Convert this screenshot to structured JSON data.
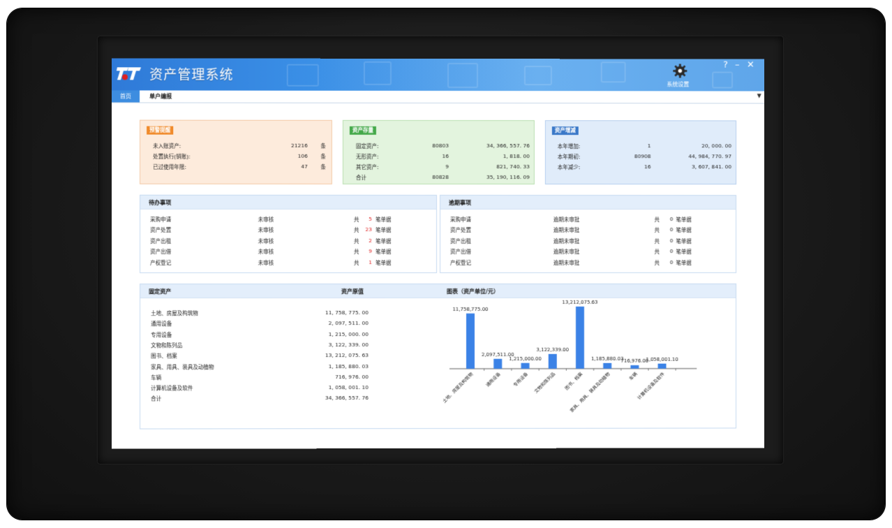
{
  "app": {
    "title": "资产管理系统",
    "settings_label": "系统设置"
  },
  "window_controls": {
    "help": "?",
    "minimize": "–",
    "close": "✕"
  },
  "tabs": [
    {
      "label": "首页"
    },
    {
      "label": "单户编报"
    }
  ],
  "warning": {
    "badge": "预警提醒",
    "rows": [
      {
        "label": "未入账资产:",
        "count": "21216",
        "unit": "条"
      },
      {
        "label": "处置执行(销账):",
        "count": "106",
        "unit": "条"
      },
      {
        "label": "已过使用年限:",
        "count": "47",
        "unit": "条"
      }
    ]
  },
  "inventory": {
    "badge": "资产存量",
    "rows": [
      {
        "label": "固定资产:",
        "count": "80803",
        "amount": "34, 366, 557. 76"
      },
      {
        "label": "无形资产:",
        "count": "16",
        "amount": "1, 818. 00"
      },
      {
        "label": "其它资产:",
        "count": "9",
        "amount": "821, 740. 33"
      },
      {
        "label": "合计",
        "count": "80828",
        "amount": "35, 190, 116. 09"
      }
    ]
  },
  "change": {
    "badge": "资产增减",
    "rows": [
      {
        "label": "本年增加:",
        "count": "1",
        "amount": "20, 000. 00"
      },
      {
        "label": "本年期初:",
        "count": "80908",
        "amount": "44, 984, 770. 97"
      },
      {
        "label": "本年减少:",
        "count": "16",
        "amount": "3, 607, 841. 00"
      }
    ]
  },
  "todo": {
    "title": "待办事项",
    "rows": [
      {
        "item": "采购申请",
        "status": "未审核",
        "prefix": "共",
        "count": "5",
        "suffix": "笔单据"
      },
      {
        "item": "资产处置",
        "status": "未审核",
        "prefix": "共",
        "count": "23",
        "suffix": "笔单据"
      },
      {
        "item": "资产出租",
        "status": "未审核",
        "prefix": "共",
        "count": "2",
        "suffix": "笔单据"
      },
      {
        "item": "资产出借",
        "status": "未审核",
        "prefix": "共",
        "count": "9",
        "suffix": "笔单据"
      },
      {
        "item": "产权登记",
        "status": "未审核",
        "prefix": "共",
        "count": "1",
        "suffix": "笔单据"
      }
    ]
  },
  "overdue": {
    "title": "逾期事项",
    "rows": [
      {
        "item": "采购申请",
        "status": "逾期未审批",
        "prefix": "共",
        "count": "0",
        "suffix": "笔单据"
      },
      {
        "item": "资产处置",
        "status": "逾期未审批",
        "prefix": "共",
        "count": "0",
        "suffix": "笔单据"
      },
      {
        "item": "资产出租",
        "status": "逾期未审批",
        "prefix": "共",
        "count": "0",
        "suffix": "笔单据"
      },
      {
        "item": "资产出借",
        "status": "逾期未审批",
        "prefix": "共",
        "count": "0",
        "suffix": "笔单据"
      },
      {
        "item": "产权登记",
        "status": "逾期未审批",
        "prefix": "共",
        "count": "0",
        "suffix": "笔单据"
      }
    ]
  },
  "fixed_assets": {
    "col_name": "固定资产",
    "col_value": "资产原值",
    "chart_title": "图表（资产单位/元）",
    "rows": [
      {
        "name": "土地、房屋及构筑物",
        "value": "11, 758, 775. 00"
      },
      {
        "name": "通用设备",
        "value": "2, 097, 511. 00"
      },
      {
        "name": "专用设备",
        "value": "1, 215, 000. 00"
      },
      {
        "name": "文物和陈列品",
        "value": "3, 122, 339. 00"
      },
      {
        "name": "图书、档案",
        "value": "13, 212, 075. 63"
      },
      {
        "name": "家具、用具、装具及动植物",
        "value": "1, 185, 880. 03"
      },
      {
        "name": "车辆",
        "value": "716, 976. 00"
      },
      {
        "name": "计算机设备及软件",
        "value": "1, 058, 001. 10"
      },
      {
        "name": "合计",
        "value": "34, 366, 557. 76"
      }
    ]
  },
  "colors": {
    "accent": "#3a8fe6",
    "bar": "#3b82e6",
    "alert": "#e02020"
  },
  "chart_data": {
    "type": "bar",
    "categories": [
      "土地、房屋及构筑物",
      "通用设备",
      "专用设备",
      "文物和陈列品",
      "图书、档案",
      "家具、用具、装具及动植物",
      "车辆",
      "计算机设备及软件"
    ],
    "values": [
      11758775.0,
      2097511.0,
      1215000.0,
      3122339.0,
      13212075.63,
      1185880.03,
      716976.0,
      1058001.1
    ],
    "labels": [
      "11,758,775.00",
      "2,097,511.00",
      "1,215,000.00",
      "3,122,339.00",
      "13,212,075.63",
      "1,185,880.03",
      "716,976.00",
      "1,058,001.10"
    ],
    "title": "图表（资产单位/元）",
    "xlabel": "",
    "ylabel": "",
    "ylim": [
      0,
      13212075.63
    ],
    "grid": false,
    "legend": "none"
  }
}
